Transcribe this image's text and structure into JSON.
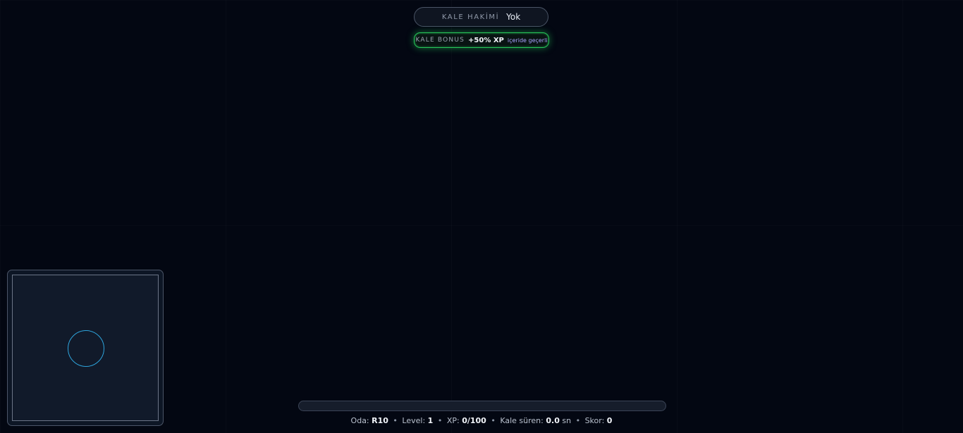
{
  "hud": {
    "king": {
      "label": "KALE HAKİMİ",
      "value": "Yok"
    },
    "bonus": {
      "label": "KALE BONUS",
      "value": "+50% XP",
      "note": "içeride geçerli",
      "color": "#27c75a"
    }
  },
  "minimap": {
    "castle_zone_color": "#2ea4dc"
  },
  "xp_bar": {
    "progress": 0
  },
  "status": {
    "room_label": "Oda:",
    "room_value": "R10",
    "level_label": "Level:",
    "level_value": "1",
    "xp_label": "XP:",
    "xp_value": "0/100",
    "castle_time_label": "Kale süren:",
    "castle_time_value": "0.0",
    "castle_time_unit": "sn",
    "score_label": "Skor:",
    "score_value": "0",
    "separator": "•"
  }
}
